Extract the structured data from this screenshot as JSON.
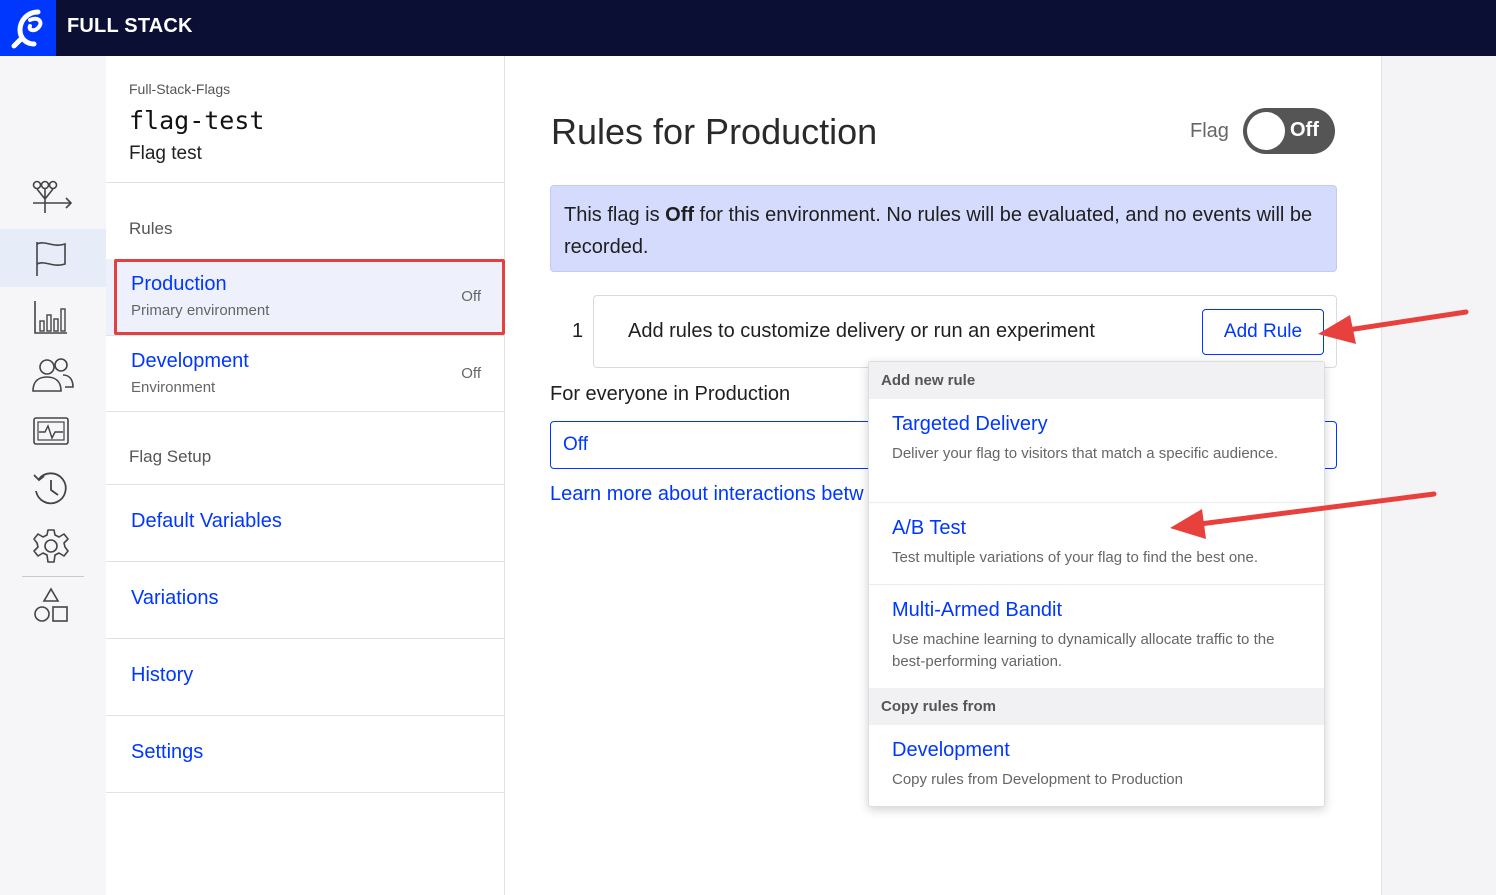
{
  "header": {
    "brand": "FULL STACK",
    "logo_icon": "optimizely-logo-icon"
  },
  "rail": {
    "items": [
      {
        "name": "flows-icon",
        "active": false
      },
      {
        "name": "flag-icon",
        "active": true
      },
      {
        "name": "reports-icon",
        "active": false
      },
      {
        "name": "audiences-icon",
        "active": false
      },
      {
        "name": "events-icon",
        "active": false
      },
      {
        "name": "history-icon",
        "active": false
      },
      {
        "name": "settings-gear-icon",
        "active": false
      },
      {
        "name": "shapes-icon",
        "active": false
      }
    ]
  },
  "nav": {
    "project": "Full-Stack-Flags",
    "flag_key": "flag-test",
    "flag_name": "Flag test",
    "rules_heading": "Rules",
    "environments": [
      {
        "name": "Production",
        "sub": "Primary environment",
        "status": "Off"
      },
      {
        "name": "Development",
        "sub": "Environment",
        "status": "Off"
      }
    ],
    "setup_heading": "Flag Setup",
    "setup_links": [
      "Default Variables",
      "Variations",
      "History",
      "Settings"
    ]
  },
  "main": {
    "title": "Rules for Production",
    "flag_label": "Flag",
    "toggle_text": "Off",
    "banner_pre": "This flag is ",
    "banner_bold": "Off",
    "banner_post": " for this environment. No rules will be evaluated, and no events will be recorded.",
    "rule_number": "1",
    "rule_text": "Add rules to customize delivery or run an experiment",
    "add_rule_label": "Add Rule",
    "everyone_label": "For everyone in Production",
    "select_value": "Off",
    "learn_more": "Learn more about interactions betw"
  },
  "dropdown": {
    "section1": "Add new rule",
    "items": [
      {
        "title": "Targeted Delivery",
        "desc": "Deliver your flag to visitors that match a specific audience."
      },
      {
        "title": "A/B Test",
        "desc": "Test multiple variations of your flag to find the best one."
      },
      {
        "title": "Multi-Armed Bandit",
        "desc": "Use machine learning to dynamically allocate traffic to the best-performing variation."
      }
    ],
    "section2": "Copy rules from",
    "copy_item": {
      "title": "Development",
      "desc": "Copy rules from Development to Production"
    }
  },
  "colors": {
    "topbar": "#0a0f33",
    "brand_blue": "#0037ff",
    "banner_bg": "#d4dbfd",
    "highlight_red": "#e2423f",
    "annotation_red": "#e8403c"
  }
}
